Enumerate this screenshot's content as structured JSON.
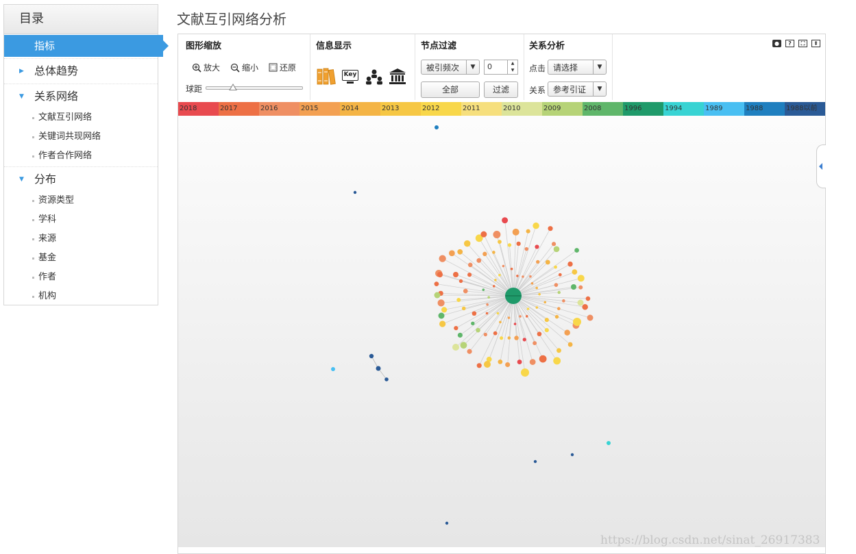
{
  "sidebar": {
    "header": "目录",
    "active_item": "指标",
    "groups": [
      {
        "label": "总体趋势",
        "expanded": false,
        "items": []
      },
      {
        "label": "关系网络",
        "expanded": true,
        "items": [
          "文献互引网络",
          "关键词共现网络",
          "作者合作网络"
        ]
      },
      {
        "label": "分布",
        "expanded": true,
        "items": [
          "资源类型",
          "学科",
          "来源",
          "基金",
          "作者",
          "机构"
        ]
      }
    ]
  },
  "page_title": "文献互引网络分析",
  "toolbar": {
    "zoom": {
      "title": "图形缩放",
      "zoom_in": "放大",
      "zoom_out": "缩小",
      "reset": "还原",
      "distance_label": "球距"
    },
    "display": {
      "title": "信息显示",
      "icons": [
        "books-icon",
        "keyword-icon",
        "people-icon",
        "institution-icon"
      ],
      "key_text": "Key"
    },
    "filter": {
      "title": "节点过滤",
      "select_value": "被引频次",
      "number_value": "0",
      "all_button": "全部",
      "filter_button": "过滤"
    },
    "relation": {
      "title": "关系分析",
      "click_label": "点击",
      "click_value": "请选择",
      "relation_label": "关系",
      "relation_value": "参考引证"
    }
  },
  "years": [
    {
      "label": "2018",
      "color": "#e84a4f"
    },
    {
      "label": "2017",
      "color": "#ed7045"
    },
    {
      "label": "2016",
      "color": "#ef8f63"
    },
    {
      "label": "2015",
      "color": "#f3a052"
    },
    {
      "label": "2014",
      "color": "#f4b445"
    },
    {
      "label": "2013",
      "color": "#f6c744"
    },
    {
      "label": "2012",
      "color": "#f8d74a"
    },
    {
      "label": "2011",
      "color": "#f6df7d"
    },
    {
      "label": "2010",
      "color": "#dce49a"
    },
    {
      "label": "2009",
      "color": "#b6d377"
    },
    {
      "label": "2008",
      "color": "#5fb66a"
    },
    {
      "label": "1996",
      "color": "#1f9a6a"
    },
    {
      "label": "1994",
      "color": "#38d3d3"
    },
    {
      "label": "1989",
      "color": "#49bff2"
    },
    {
      "label": "1988",
      "color": "#1f7fbf"
    },
    {
      "label": "1988以前",
      "color": "#2a5a96"
    }
  ],
  "watermark": "https://blog.csdn.net/sinat_26917383"
}
